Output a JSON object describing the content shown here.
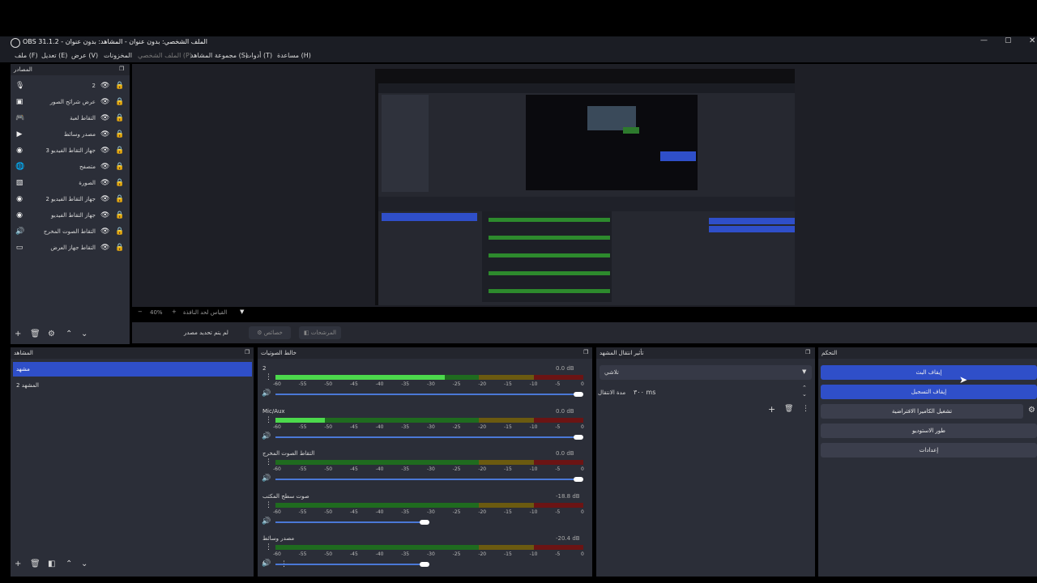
{
  "window": {
    "title": "OBS 31.1.2 - الملف الشخصي: بدون عنوان - المشاهد: بدون عنوان"
  },
  "menu": [
    "ملف (F)",
    "تعديل (E)",
    "عرض (V)",
    "المخزونات",
    "الملف الشخصي (P)",
    "مجموعة المشاهد (S)",
    "أدوات (T)",
    "مساعدة (H)"
  ],
  "sources": {
    "title": "المصادر",
    "items": [
      {
        "label": "2",
        "icon": "mic-icon"
      },
      {
        "label": "عرض شرائح الصور",
        "icon": "slideshow-icon"
      },
      {
        "label": "التقاط لعبة",
        "icon": "gamepad-icon"
      },
      {
        "label": "مصدر وسائط",
        "icon": "play-icon"
      },
      {
        "label": "جهاز التقاط الفيديو 3",
        "icon": "camera-icon"
      },
      {
        "label": "متصفح",
        "icon": "globe-icon"
      },
      {
        "label": "الصورة",
        "icon": "image-icon"
      },
      {
        "label": "جهاز التقاط الفيديو 2",
        "icon": "camera-icon"
      },
      {
        "label": "جهاز التقاط الفيديو",
        "icon": "camera-icon"
      },
      {
        "label": "التقاط الصوت المخرج",
        "icon": "speaker-icon"
      },
      {
        "label": "التقاط جهاز العرض",
        "icon": "monitor-icon"
      }
    ]
  },
  "preview": {
    "zoom": "40%",
    "zoom_mode": "القياس لحد النافذة"
  },
  "context_bar": {
    "no_source": "لم يتم تحديد مصدر",
    "properties": "خصائص",
    "filters": "المرشحات"
  },
  "scenes": {
    "title": "المشاهد",
    "items": [
      "مشهد",
      "المشهد 2"
    ]
  },
  "mixer": {
    "title": "خالط الصوتيات",
    "ticks": [
      "-60",
      "-55",
      "-50",
      "-45",
      "-40",
      "-35",
      "-30",
      "-25",
      "-20",
      "-15",
      "-10",
      "-5",
      "0"
    ],
    "channels": [
      {
        "name": "2",
        "db": "0.0 dB",
        "level": 0.55,
        "volume": 1.0
      },
      {
        "name": "Mic/Aux",
        "db": "0.0 dB",
        "level": 0.16,
        "volume": 1.0
      },
      {
        "name": "التقاط الصوت المخرج",
        "db": "0.0 dB",
        "level": 0,
        "volume": 1.0
      },
      {
        "name": "صوت سطح المكتب",
        "db": "-18.8 dB",
        "level": 0,
        "volume": 0.5
      },
      {
        "name": "مصدر وسائط",
        "db": "-20.4 dB",
        "level": 0,
        "volume": 0.5
      }
    ]
  },
  "transitions": {
    "title": "تأثير انتقال المشهد",
    "type": "تلاشي",
    "duration_label": "مدة الانتقال",
    "duration": "٣٠٠ ms"
  },
  "controls": {
    "title": "التحكم",
    "buttons": [
      "إيقاف البث",
      "إيقاف التسجيل",
      "تشغيل الكاميرا الافتراضية",
      "طور الاستوديو",
      "إعدادات"
    ]
  },
  "colors": {
    "accent": "#2f4fc9",
    "bg": "#2b2e38",
    "header": "#23252d"
  }
}
